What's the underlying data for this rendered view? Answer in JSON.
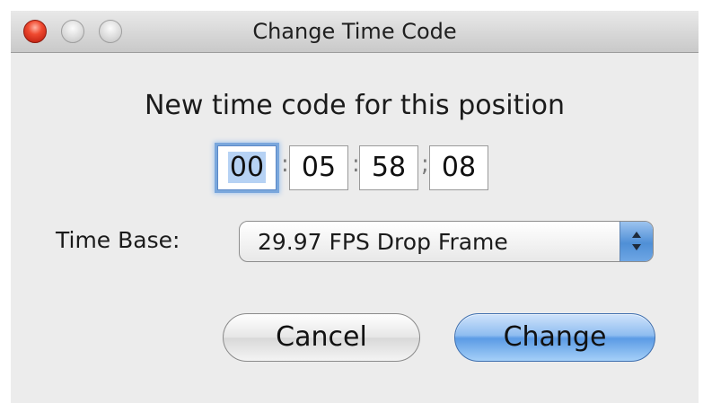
{
  "window": {
    "title": "Change Time Code"
  },
  "prompt": "New time code for this position",
  "timecode": {
    "hours": "00",
    "minutes": "05",
    "seconds": "58",
    "frames": "08",
    "separators": [
      ":",
      ":",
      ";"
    ]
  },
  "time_base": {
    "label": "Time Base:",
    "selected": "29.97 FPS Drop Frame"
  },
  "buttons": {
    "cancel": "Cancel",
    "change": "Change"
  },
  "colors": {
    "accent_blue": "#5b9be5",
    "close_red": "#ef4a30",
    "window_bg": "#ececec"
  }
}
